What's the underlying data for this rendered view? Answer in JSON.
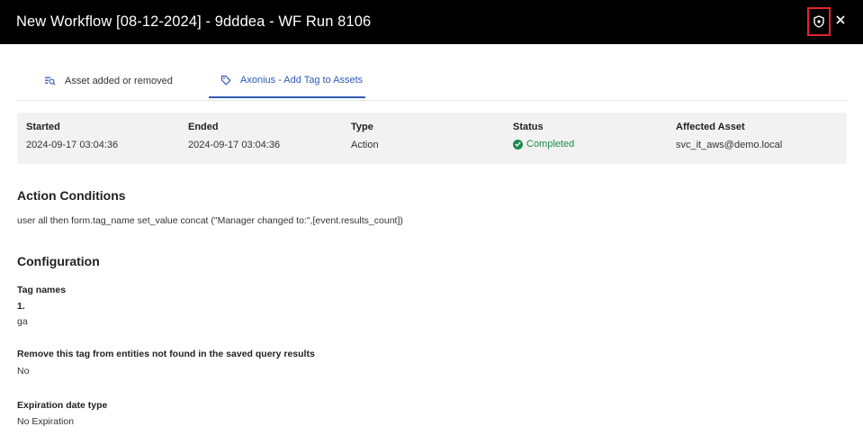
{
  "header": {
    "title": "New Workflow [08-12-2024] - 9dddea - WF Run 8106",
    "shield_icon": "shield-icon",
    "close_icon": "close-icon",
    "accent_color": "#e0262c"
  },
  "tabs": [
    {
      "label": "Asset added or removed",
      "icon": "asset-search-icon",
      "active": false
    },
    {
      "label": "Axonius - Add Tag to Assets",
      "icon": "tag-icon",
      "active": true
    }
  ],
  "summary": {
    "started_label": "Started",
    "started_value": "2024-09-17 03:04:36",
    "ended_label": "Ended",
    "ended_value": "2024-09-17 03:04:36",
    "type_label": "Type",
    "type_value": "Action",
    "status_label": "Status",
    "status_value": "Completed",
    "status_color": "#1e8a4e",
    "asset_label": "Affected Asset",
    "asset_value": "svc_it_aws@demo.local"
  },
  "action_conditions": {
    "title": "Action Conditions",
    "text": "user all then form.tag_name set_value concat (\"Manager changed to:\",[event.results_count])"
  },
  "configuration": {
    "title": "Configuration",
    "tag_names_label": "Tag names",
    "tag_item_index": "1.",
    "tag_item_value": "ga",
    "remove_label": "Remove this tag from entities not found in the saved query results",
    "remove_value": "No",
    "expiration_label": "Expiration date type",
    "expiration_value": "No Expiration"
  }
}
